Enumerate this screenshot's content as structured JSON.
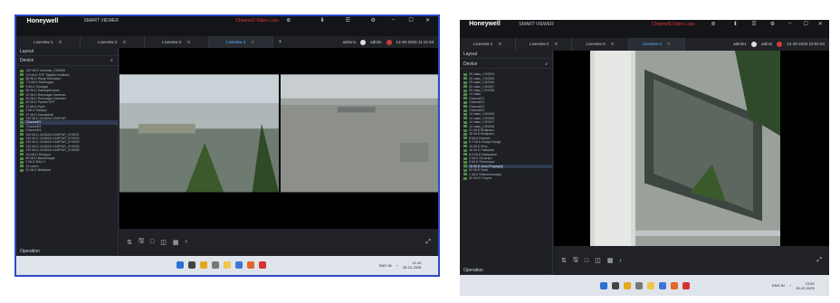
{
  "colors": {
    "accent": "#2b4cc4",
    "tab_active": "#62b4ff",
    "alert": "#e33232"
  },
  "app": {
    "brand": "Honeywell",
    "name": "SMART VIEWER",
    "alert_text": "Channel3 Video Loss"
  },
  "window_controls": [
    "⊛",
    "⬇",
    "☰",
    "⚙",
    "–",
    "☐",
    "✕"
  ],
  "tabs": [
    {
      "label": "Liveview-1",
      "active": false
    },
    {
      "label": "Liveview-2",
      "active": false
    },
    {
      "label": "Liveview-3",
      "active": false
    },
    {
      "label": "Liveview-4",
      "active": true
    }
  ],
  "users": {
    "primary": "admin1",
    "secondary": "admin"
  },
  "sidebar": {
    "layout": "Layout",
    "device": "Device",
    "operation": "Operation"
  },
  "shot1": {
    "datetime": "12-30-2025 11:10:48",
    "tree": [
      "140 MLD Varanasi_CH0008",
      "3.5 MLD STP Tajalam Nolabad",
      "68 MLD Rangi Dehradun",
      "7.5 MLD Ramnagar",
      "5 MLD Srinagar",
      "50 MLD Dasanjolivaram",
      "10 MLD Ramnagar Varanasi",
      "50 MLD Ramnagar Varanasi",
      "60 MLD Parnibi STP",
      "11 MLD Ranh",
      "3 MLD Saidpur",
      "37 MLD Kamalchak",
      "130 MLD JAJMAU KANPUR",
      "Channel01",
      "Channel02",
      "Channel03",
      "130 MLD JAJMAU KANPUR_CH0001",
      "130 MLD JAJMAU KANPUR_CH0002",
      "130 MLD JAJMAU KANPUR_CH0003",
      "130 MLD JAJMAU KANPUR_CH0004",
      "130 MLD JAJMAU KANPUR_CH0005",
      "3.5 MLD Dimapur",
      "60 MLD Barakmagar",
      "2 MLD BALLY",
      "14 vation",
      "31 MLD Bhatpara"
    ],
    "selected": 13,
    "clock_time": "11:10",
    "clock_date": "30-12-2025",
    "tray_lang": "ENG IN"
  },
  "shot2": {
    "datetime": "12-30-2025 10:52:04",
    "tree": [
      "29 valan_CH0004",
      "29 valan_CH0005",
      "29 valan_CH0006",
      "29 valan_CH0007",
      "29 valan_CH0008",
      "14 valan",
      "Channel01",
      "Channel02",
      "Channel03",
      "Channel04",
      "14 valan_CH0005",
      "14 valan_CH0006",
      "14 valan_CH0007",
      "14 valan_CH0008",
      "31 MLD Bhatpara",
      "18 MLD Bhatpara",
      "8 MLD Hawrah",
      "9.2 MLD Budge Budge",
      "43 MLD Bhur",
      "16 MLD Halisahar",
      "8.5 MLD Baidyabati",
      "4 MLD Sonarpur",
      "5 MLD Shrirampur",
      "18 MLD Jhusi Prayagraj",
      "60 MLD Naini",
      "2 MLD Srikrishnanagar",
      "32 MLD Chapra"
    ],
    "selected": 23,
    "clock_time": "10:52",
    "clock_date": "30-12-2025",
    "tray_lang": "ENG IN"
  },
  "controls": [
    "⇅",
    "🖫",
    "□",
    "◫",
    "▦",
    "›"
  ],
  "taskbar_apps": [
    "win-start",
    "search",
    "chrome",
    "files",
    "explorer",
    "mail",
    "firefox",
    "smartviewer"
  ]
}
